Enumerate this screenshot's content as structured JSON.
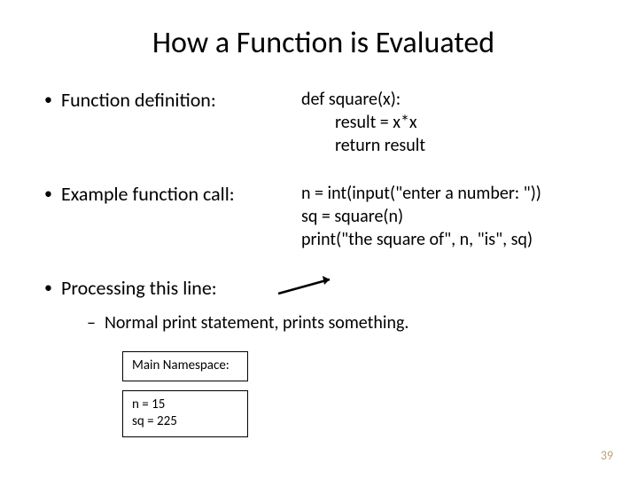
{
  "title": "How a Function is Evaluated",
  "bullets": {
    "def": "Function definition:",
    "call": "Example function call:",
    "proc": "Processing this line:"
  },
  "code_def": {
    "l1": "def square(x):",
    "l2": "result = x*x",
    "l3": "return result"
  },
  "code_call": {
    "l1": "n = int(input(\"enter a number: \"))",
    "l2": "sq = square(n)",
    "l3": "print(\"the square of\", n, \"is\", sq)"
  },
  "sub": "Normal print statement, prints something.",
  "box1": {
    "title": "Main Namespace:"
  },
  "box2": {
    "l1": "n = 15",
    "l2": "sq = 225"
  },
  "page": "39"
}
